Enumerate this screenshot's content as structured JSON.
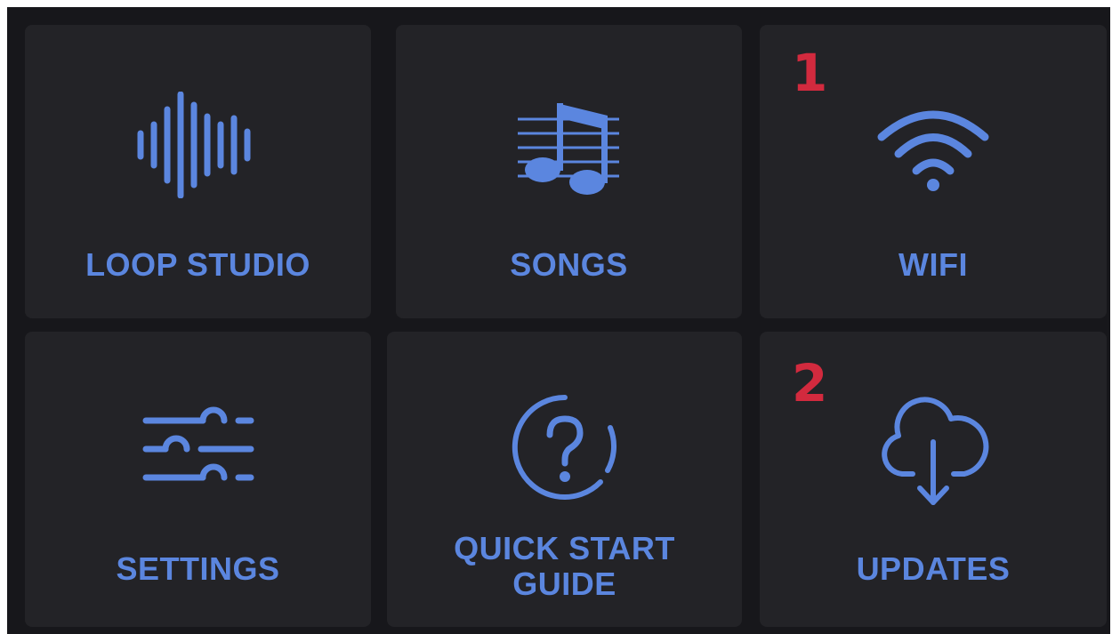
{
  "menu": {
    "tiles": [
      {
        "label": "LOOP STUDIO",
        "icon": "waveform-icon"
      },
      {
        "label": "SONGS",
        "icon": "music-notes-icon"
      },
      {
        "label": "WIFI",
        "icon": "wifi-icon",
        "badge": "1"
      },
      {
        "label": "SETTINGS",
        "icon": "sliders-icon"
      },
      {
        "label_lines": [
          "QUICK START",
          "GUIDE"
        ],
        "icon": "question-circle-icon"
      },
      {
        "label": "UPDATES",
        "icon": "cloud-download-icon",
        "badge": "2"
      }
    ]
  },
  "colors": {
    "background": "#17171b",
    "tile": "#232327",
    "accent": "#5b86df",
    "badge": "#d22a3e"
  }
}
